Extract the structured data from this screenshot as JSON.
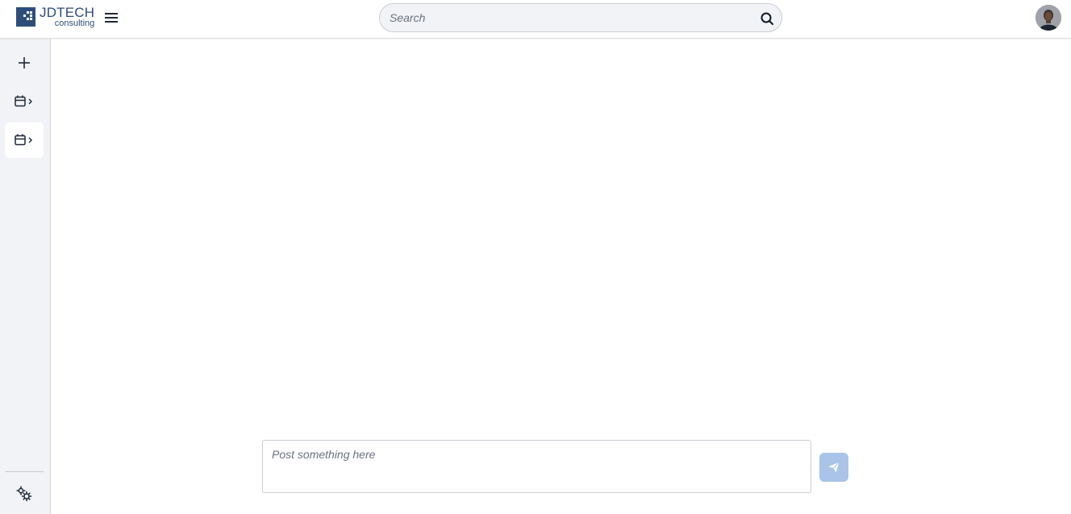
{
  "brand": {
    "name": "JDTECH",
    "subtitle": "consulting",
    "color": "#2e4e7a"
  },
  "header": {
    "menu_icon": "hamburger-menu-icon",
    "search": {
      "placeholder": "Search",
      "value": "",
      "icon": "search-icon"
    },
    "avatar_icon": "user-avatar"
  },
  "sidebar": {
    "items": [
      {
        "id": "new",
        "icon": "plus-icon",
        "active": false
      },
      {
        "id": "calendar-1",
        "icon": "calendar-chevron-right-icon",
        "active": false
      },
      {
        "id": "calendar-2",
        "icon": "calendar-chevron-right-icon",
        "active": true
      }
    ],
    "footer_icon": "settings-gears-icon"
  },
  "composer": {
    "placeholder": "Post something here",
    "value": "",
    "send_icon": "send-paper-plane-icon",
    "send_color": "#a9c4e8"
  },
  "colors": {
    "sidebar_bg": "#f1f3f6",
    "accent": "#2e4e7a"
  }
}
